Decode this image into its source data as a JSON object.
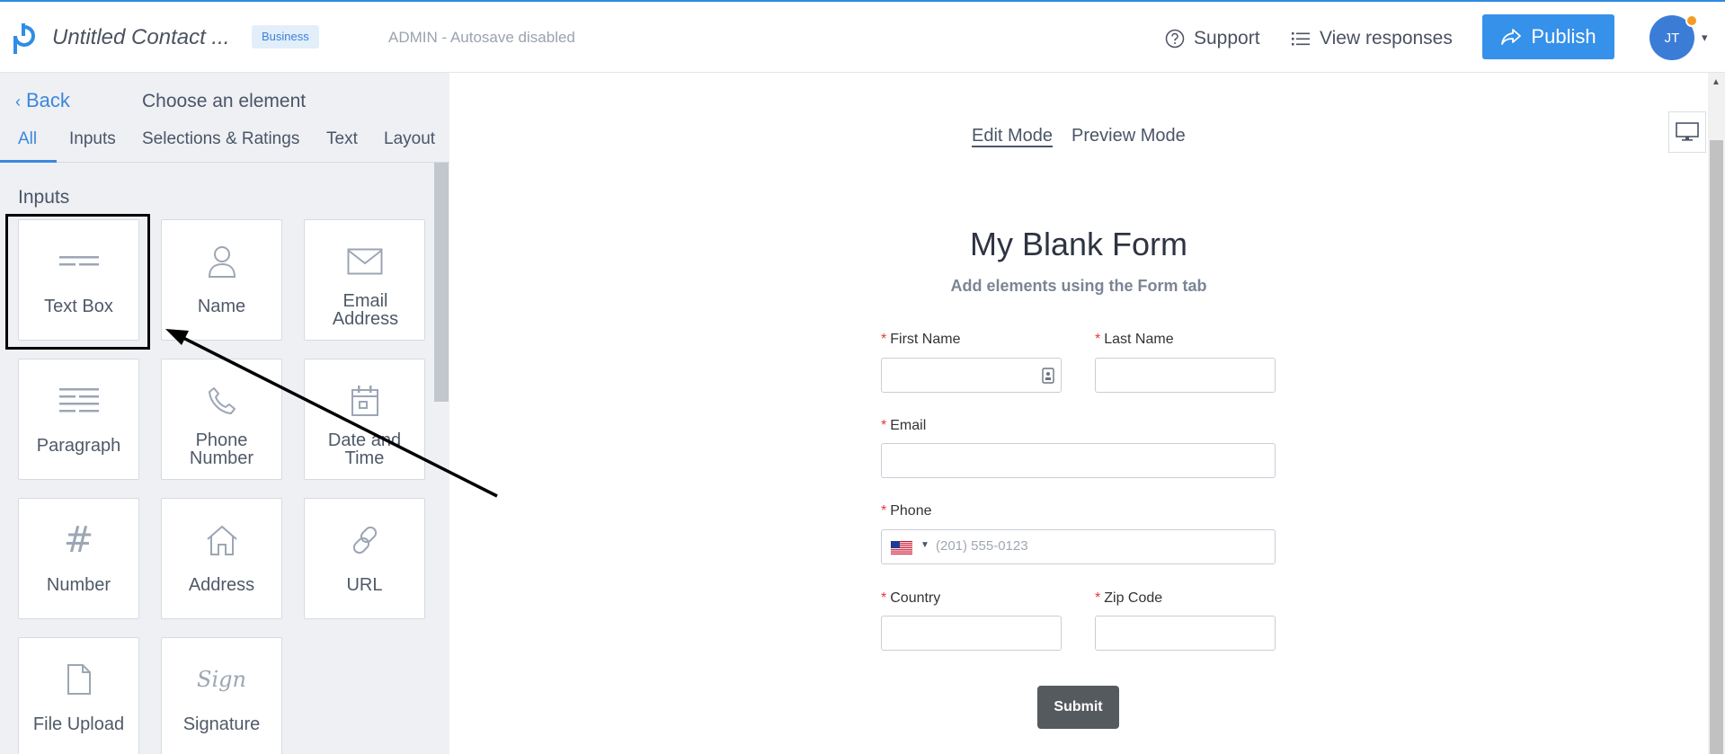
{
  "header": {
    "form_title": "Untitled Contact ...",
    "plan_badge": "Business",
    "autosave_status": "ADMIN - Autosave disabled",
    "support_label": "Support",
    "view_responses_label": "View responses",
    "publish_label": "Publish",
    "avatar_initials": "JT"
  },
  "sidebar": {
    "back_label": "Back",
    "title": "Choose an element",
    "tabs": [
      "All",
      "Inputs",
      "Selections & Ratings",
      "Text",
      "Layout"
    ],
    "active_tab": "All",
    "section_title": "Inputs",
    "elements": [
      {
        "label": "Text Box",
        "icon": "text-box-icon"
      },
      {
        "label": "Name",
        "icon": "person-icon"
      },
      {
        "label": "Email Address",
        "icon": "envelope-icon"
      },
      {
        "label": "Paragraph",
        "icon": "paragraph-icon"
      },
      {
        "label": "Phone Number",
        "icon": "phone-icon"
      },
      {
        "label": "Date and Time",
        "icon": "calendar-icon"
      },
      {
        "label": "Number",
        "icon": "hash-icon"
      },
      {
        "label": "Address",
        "icon": "house-icon"
      },
      {
        "label": "URL",
        "icon": "link-icon"
      },
      {
        "label": "File Upload",
        "icon": "file-icon"
      },
      {
        "label": "Signature",
        "icon": "signature-icon"
      }
    ]
  },
  "canvas": {
    "edit_mode_label": "Edit Mode",
    "preview_mode_label": "Preview Mode",
    "form": {
      "title": "My Blank Form",
      "subtitle": "Add elements using the Form tab",
      "fields": {
        "first_name": "First Name",
        "last_name": "Last Name",
        "email": "Email",
        "phone": "Phone",
        "phone_placeholder": "(201) 555-0123",
        "country": "Country",
        "zip": "Zip Code"
      },
      "required_marker": "*",
      "submit_label": "Submit"
    }
  },
  "colors": {
    "accent": "#3591ea",
    "notification_dot": "#f59a23",
    "required": "#e53935"
  }
}
